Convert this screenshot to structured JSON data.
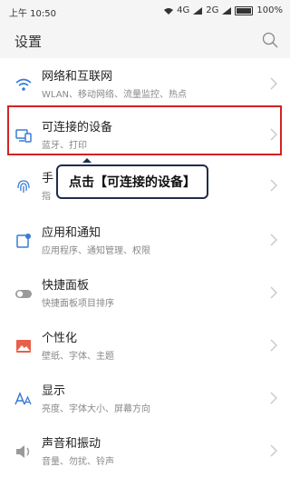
{
  "status": {
    "time": "上午 10:50",
    "network": "4G",
    "network2": "2G",
    "battery": "100%"
  },
  "header": {
    "title": "设置",
    "search_icon": "search-icon"
  },
  "items": [
    {
      "label": "网络和互联网",
      "sub": "WLAN、移动网络、流量监控、热点",
      "icon": "wifi-icon"
    },
    {
      "label": "可连接的设备",
      "sub": "蓝牙、打印",
      "icon": "devices-icon"
    },
    {
      "label": "手",
      "sub": "指",
      "icon": "fingerprint-icon"
    },
    {
      "label": "应用和通知",
      "sub": "应用程序、通知管理、权限",
      "icon": "apps-icon"
    },
    {
      "label": "快捷面板",
      "sub": "快捷面板项目排序",
      "icon": "toggle-icon"
    },
    {
      "label": "个性化",
      "sub": "壁纸、字体、主题",
      "icon": "image-icon"
    },
    {
      "label": "显示",
      "sub": "亮度、字体大小、屏幕方向",
      "icon": "text-size-icon"
    },
    {
      "label": "声音和振动",
      "sub": "音量、勿扰、铃声",
      "icon": "speaker-icon"
    }
  ],
  "callout": {
    "text": "点击【可连接的设备】"
  },
  "colors": {
    "accent": "#3a7bd5",
    "highlight": "#d42222",
    "callout_border": "#1f2d4a"
  }
}
